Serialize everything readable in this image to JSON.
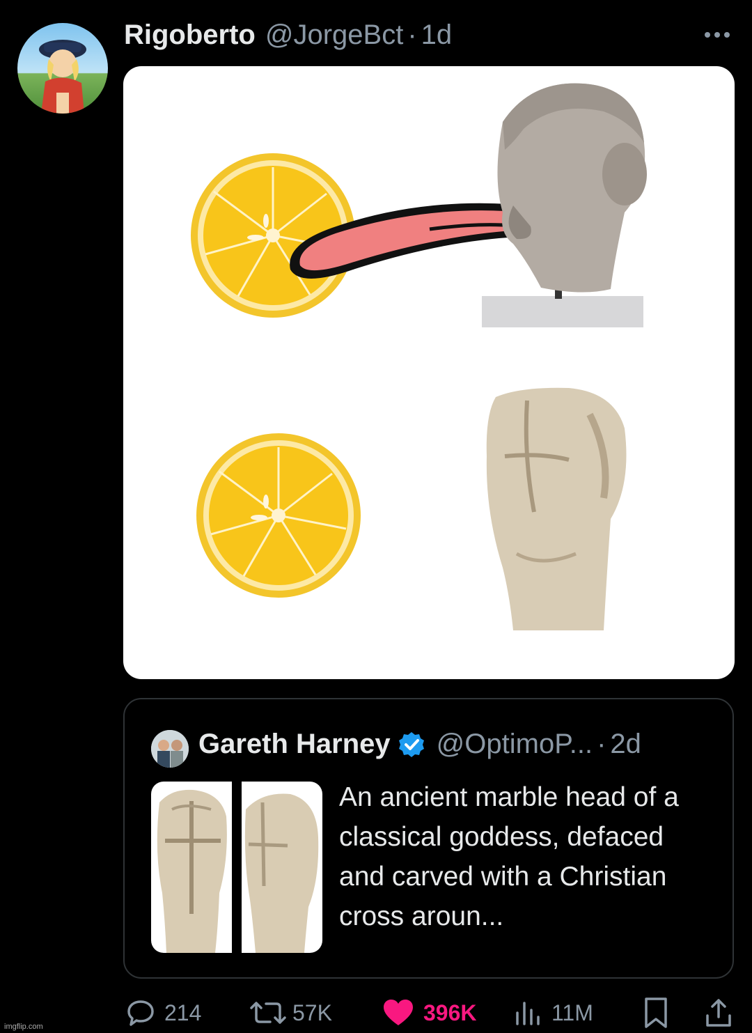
{
  "tweet": {
    "display_name": "Rigoberto",
    "handle": "@JorgeBct",
    "separator": "·",
    "time": "1d",
    "more_icon": "more-horizontal-icon"
  },
  "quoted_tweet": {
    "display_name": "Gareth Harney",
    "verified": true,
    "handle": "@OptimoP...",
    "separator": "·",
    "time": "2d",
    "text": "An ancient marble head of a classical goddess, defaced and carved with a Christian cross aroun..."
  },
  "actions": {
    "replies": "214",
    "reposts": "57K",
    "likes": "396K",
    "views": "11M",
    "like_color": "#f91880",
    "icons": [
      "reply-icon",
      "repost-icon",
      "heart-icon",
      "views-icon",
      "bookmark-icon",
      "share-icon"
    ]
  },
  "watermark": "imgflip.com"
}
